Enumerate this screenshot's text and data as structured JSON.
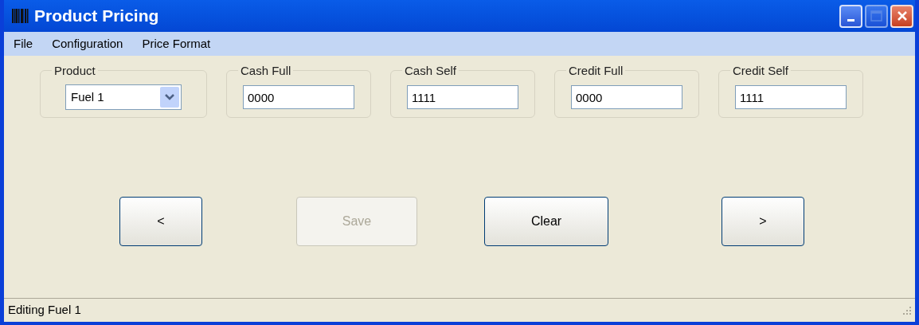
{
  "window": {
    "title": "Product Pricing",
    "controls": [
      {
        "kind": "minimize",
        "disabled": false
      },
      {
        "kind": "maximize",
        "disabled": true
      },
      {
        "kind": "close",
        "disabled": false
      }
    ]
  },
  "menu": [
    "File",
    "Configuration",
    "Price Format"
  ],
  "groups": [
    {
      "kind": "dropdown",
      "label": "Product",
      "value": "Fuel 1"
    },
    {
      "kind": "field",
      "label": "Cash Full",
      "value": "0000"
    },
    {
      "kind": "field",
      "label": "Cash Self",
      "value": "1111"
    },
    {
      "kind": "field",
      "label": "Credit Full",
      "value": "0000"
    },
    {
      "kind": "field",
      "label": "Credit Self",
      "value": "1111"
    }
  ],
  "buttons": [
    {
      "label": "<",
      "disabled": false
    },
    {
      "label": "Save",
      "disabled": true
    },
    {
      "label": "Clear",
      "disabled": false
    },
    {
      "label": ">",
      "disabled": false
    }
  ],
  "status_bar": "Editing Fuel 1"
}
